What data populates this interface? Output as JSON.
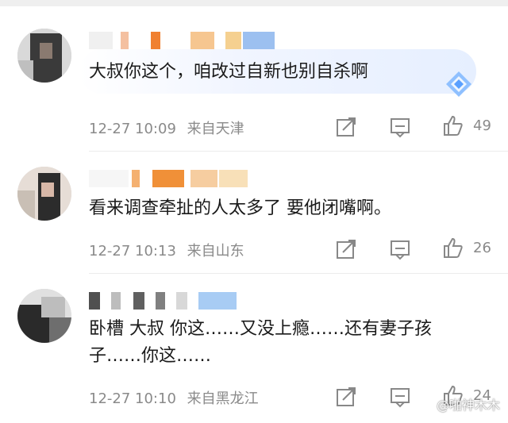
{
  "comments": [
    {
      "text": "大叔你这个，咱改过自新也别自杀啊",
      "date": "12-27 10:09",
      "location": "来自天津",
      "likes": "49"
    },
    {
      "text": "看来调查牵扯的人太多了 要他闭嘴啊。",
      "date": "12-27 10:13",
      "location": "来自山东",
      "likes": "26"
    },
    {
      "text": "卧槽 大叔 你这……又没上瘾……还有妻子孩\n子……你这……",
      "date": "12-27 10:10",
      "location": "来自黑龙江",
      "likes": "24"
    }
  ],
  "icons": {
    "share": "share-icon",
    "comment": "comment-icon",
    "like": "thumbs-up-icon",
    "badge": "diamond-badge-icon"
  },
  "colors": {
    "meta": "#8a8a8a",
    "badge": "#5aa0ff"
  },
  "watermark": "@啪神木木"
}
